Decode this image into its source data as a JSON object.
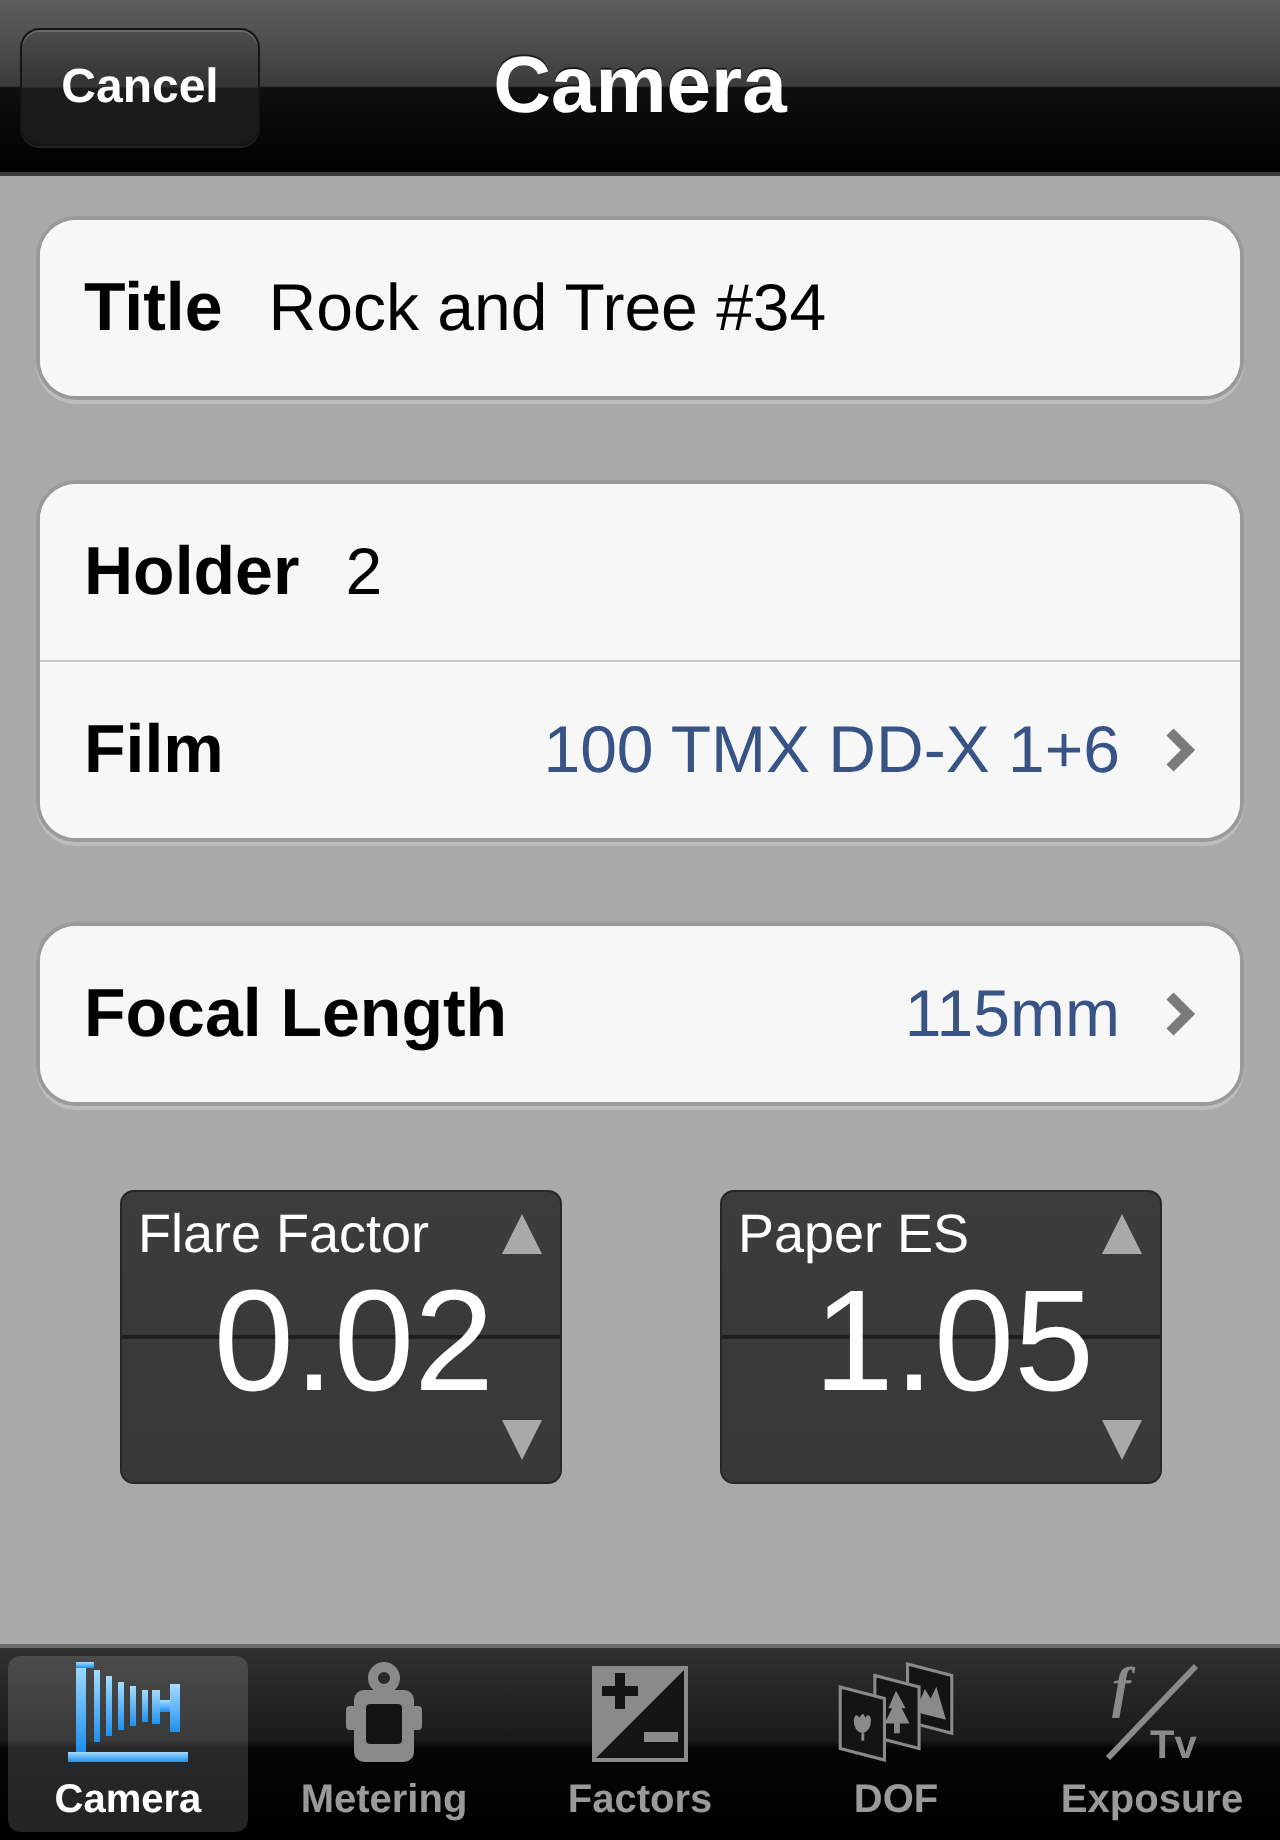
{
  "nav_bar": {
    "cancel_button": "Cancel",
    "title": "Camera"
  },
  "groups": [
    {
      "rows": [
        {
          "kind": "field",
          "label": "Title",
          "value": "Rock and Tree #34"
        }
      ]
    },
    {
      "rows": [
        {
          "kind": "field",
          "label": "Holder",
          "value": "2"
        },
        {
          "kind": "disclosure",
          "label": "Film",
          "value": "100 TMX DD-X 1+6"
        }
      ]
    },
    {
      "rows": [
        {
          "kind": "disclosure",
          "label": "Focal Length",
          "value": "115mm"
        }
      ]
    }
  ],
  "steppers": [
    {
      "label": "Flare Factor",
      "value": "0.02"
    },
    {
      "label": "Paper ES",
      "value": "1.05"
    }
  ],
  "tab_bar": [
    {
      "kind": "camera",
      "label": "Camera",
      "selected": true
    },
    {
      "kind": "meter",
      "label": "Metering",
      "selected": false
    },
    {
      "kind": "factors",
      "label": "Factors",
      "selected": false
    },
    {
      "kind": "dof",
      "label": "DOF",
      "selected": false
    },
    {
      "kind": "exposure",
      "label": "Exposure",
      "selected": false,
      "icon_text": [
        "f",
        "Tv"
      ]
    }
  ]
}
